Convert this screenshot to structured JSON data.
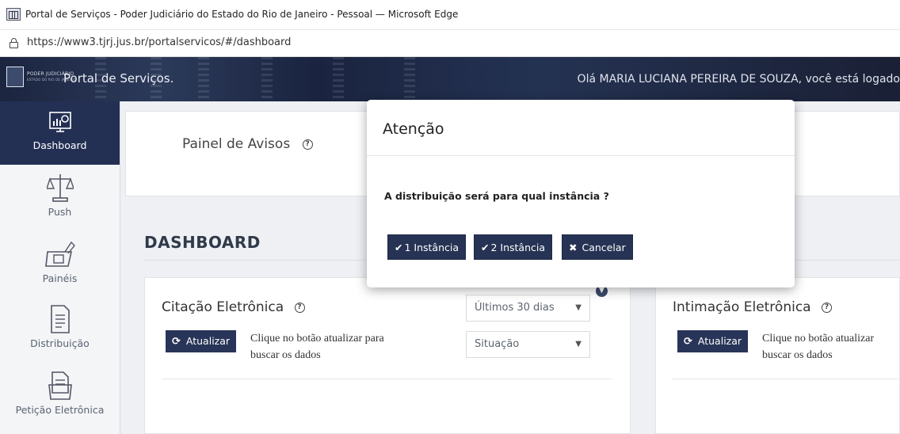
{
  "window": {
    "title": "Portal de Serviços - Poder Judiciário do Estado do Rio de Janeiro - Pessoal — Microsoft Edge",
    "url": "https://www3.tjrj.jus.br/portalservicos/#/dashboard"
  },
  "header": {
    "logo_text": "PODER JUDICIÁRIO",
    "logo_subtext": "ESTADO DO RIO DE JANEIRO",
    "portal_title": "Portal de Serviços.",
    "greeting": "Olá MARIA LUCIANA PEREIRA DE SOUZA, você está logado"
  },
  "sidebar": {
    "items": [
      {
        "label": "Dashboard",
        "icon": "dashboard-chart-icon",
        "active": true
      },
      {
        "label": "Push",
        "icon": "scales-icon",
        "active": false
      },
      {
        "label": "Painéis",
        "icon": "panel-icon",
        "active": false
      },
      {
        "label": "Distribuição",
        "icon": "document-icon",
        "active": false
      },
      {
        "label": "Petição Eletrônica",
        "icon": "folder-icon",
        "active": false
      }
    ]
  },
  "main": {
    "avisos_title": "Painel de Avisos",
    "dashboard_title": "DASHBOARD",
    "citacao": {
      "title": "Citação Eletrônica",
      "refresh_label": "Atualizar",
      "hint_line1": "Clique no botão atualizar para",
      "hint_line2": "buscar os dados",
      "period_select": "Últimos 30 dias",
      "status_select": "Situação"
    },
    "intimacao": {
      "title": "Intimação Eletrônica",
      "refresh_label": "Atualizar",
      "hint_line1": "Clique no botão atualizar",
      "hint_line2": "buscar os dados"
    }
  },
  "modal": {
    "title": "Atenção",
    "question": "A distribuição será para qual instância ?",
    "buttons": {
      "first": "1 Instância",
      "second": "2 Instância",
      "cancel": "Cancelar"
    }
  },
  "colors": {
    "primary": "#263354",
    "sidebar_active": "#233054",
    "background": "#eef0f3"
  }
}
